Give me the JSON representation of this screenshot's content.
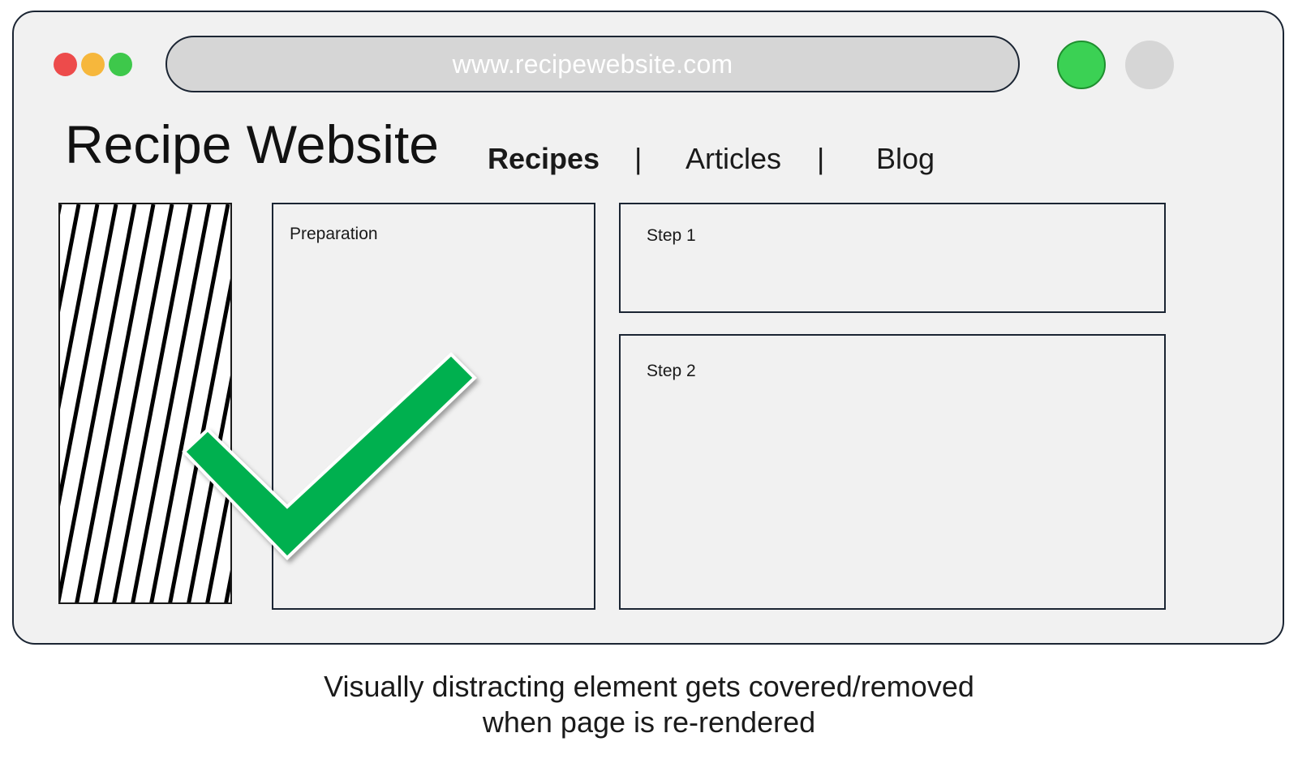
{
  "browser": {
    "url": "www.recipewebsite.com",
    "traffic_lights": [
      "red",
      "yellow",
      "green"
    ],
    "buttons": [
      "green-circle",
      "gray-circle"
    ]
  },
  "site": {
    "title": "Recipe Website",
    "nav": {
      "recipes": "Recipes",
      "separator": "|",
      "articles": "Articles",
      "blog": "Blog"
    }
  },
  "panels": {
    "preparation": "Preparation",
    "step1": "Step 1",
    "step2": "Step 2"
  },
  "overlay": {
    "icon": "checkmark-icon",
    "color": "#03b050"
  },
  "caption": {
    "line1": "Visually distracting element gets covered/removed",
    "line2": "when page is re-rendered"
  },
  "colors": {
    "frame_bg": "#f1f1f1",
    "frame_border": "#1b2533",
    "url_bar": "#d6d6d6",
    "accent_green": "#3bd154",
    "check_green": "#03b050"
  }
}
